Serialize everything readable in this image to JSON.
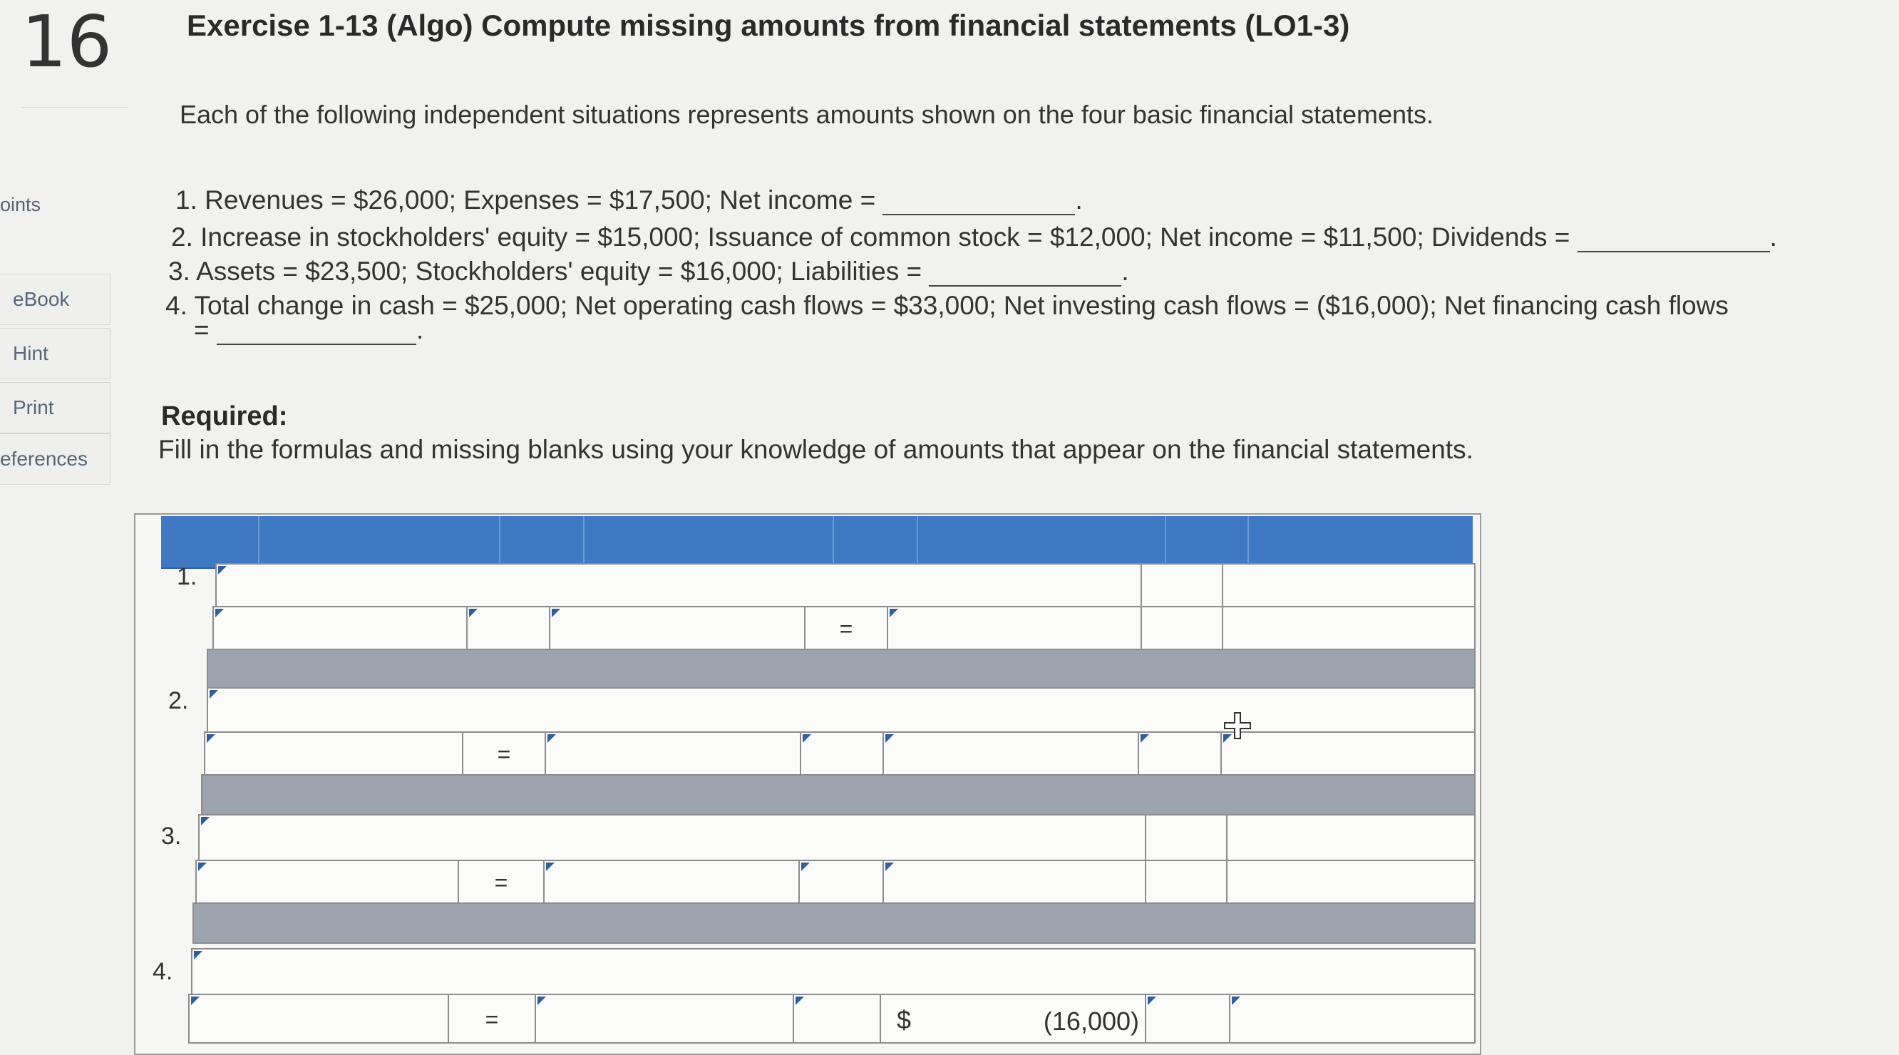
{
  "question": {
    "number": "16"
  },
  "sidebar": {
    "points_label": "oints",
    "items": [
      {
        "label": "eBook"
      },
      {
        "label": "Hint"
      },
      {
        "label": "Print"
      },
      {
        "label": "eferences"
      }
    ]
  },
  "header": {
    "title": "Exercise 1-13 (Algo) Compute missing amounts from financial statements (LO1-3)"
  },
  "intro": "Each of the following independent situations represents amounts shown on the four basic financial statements.",
  "situations": [
    {
      "text": "1. Revenues = $26,000; Expenses = $17,500; Net income = ",
      "end": "."
    },
    {
      "text": "2. Increase in stockholders' equity = $15,000; Issuance of common stock = $12,000; Net income = $11,500; Dividends = ",
      "end": "."
    },
    {
      "text": "3. Assets = $23,500; Stockholders' equity = $16,000; Liabilities = ",
      "end": "."
    },
    {
      "text": "4. Total change in cash = $25,000; Net operating cash flows = $33,000; Net investing cash flows = ($16,000); Net financing cash flows",
      "cont": "= ",
      "end": "."
    }
  ],
  "required": {
    "label": "Required:",
    "text": "Fill in the formulas and missing blanks using your knowledge of amounts that appear on the financial statements."
  },
  "table": {
    "rows": [
      {
        "num": "1."
      },
      {
        "num": "2."
      },
      {
        "num": "3."
      },
      {
        "num": "4."
      }
    ],
    "eq_symbol": "=",
    "row4_dollar": "$",
    "row4_amount": "(16,000)"
  }
}
